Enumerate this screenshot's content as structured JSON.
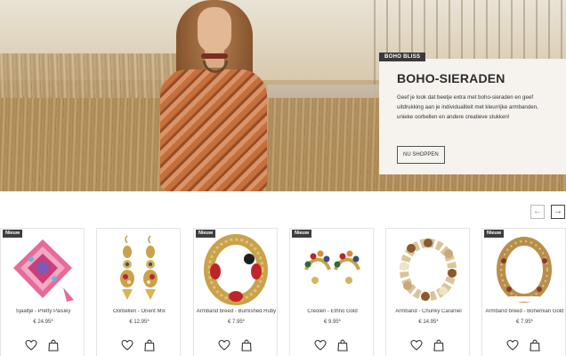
{
  "hero": {
    "tag": "BOHO BLISS",
    "title": "BOHO-SIERADEN",
    "text": "Geef je look dat beetje extra met boho-sieraden en geef uitdrukking aan je individualiteit met kleurrijke armbanden, unieke oorbellen en andere creatieve stukken!",
    "button": "NU SHOPPEN"
  },
  "carousel": {
    "prev_icon": "arrow-left-icon",
    "next_icon": "arrow-right-icon",
    "prev_glyph": "←",
    "next_glyph": "→"
  },
  "products": [
    {
      "badge": "Nieuw",
      "name": "Sjaaltje - Pretty Paisley",
      "price": "€ 24.95*",
      "image": "scarf-image"
    },
    {
      "badge": "",
      "name": "Oorbellen - Orient Mix",
      "price": "€ 12.95*",
      "image": "earrings-image"
    },
    {
      "badge": "Nieuw",
      "name": "Armband breed - Burnished Ruby",
      "price": "€ 7.95*",
      "image": "cuff-bracelet-image"
    },
    {
      "badge": "Nieuw",
      "name": "Creolen - Ethno Gold",
      "price": "€ 9.95*",
      "image": "hoop-earrings-image"
    },
    {
      "badge": "",
      "name": "Armband - Chunky Caramel",
      "price": "€ 14.95*",
      "image": "bead-bracelet-image"
    },
    {
      "badge": "Nieuw",
      "name": "Armband breed - Bohemian Gold",
      "price": "€ 7.95*",
      "image": "bohemian-cuff-image"
    }
  ],
  "colors": {
    "accent": "#3a3a3a",
    "promo_bg": "#f6f3ee"
  }
}
